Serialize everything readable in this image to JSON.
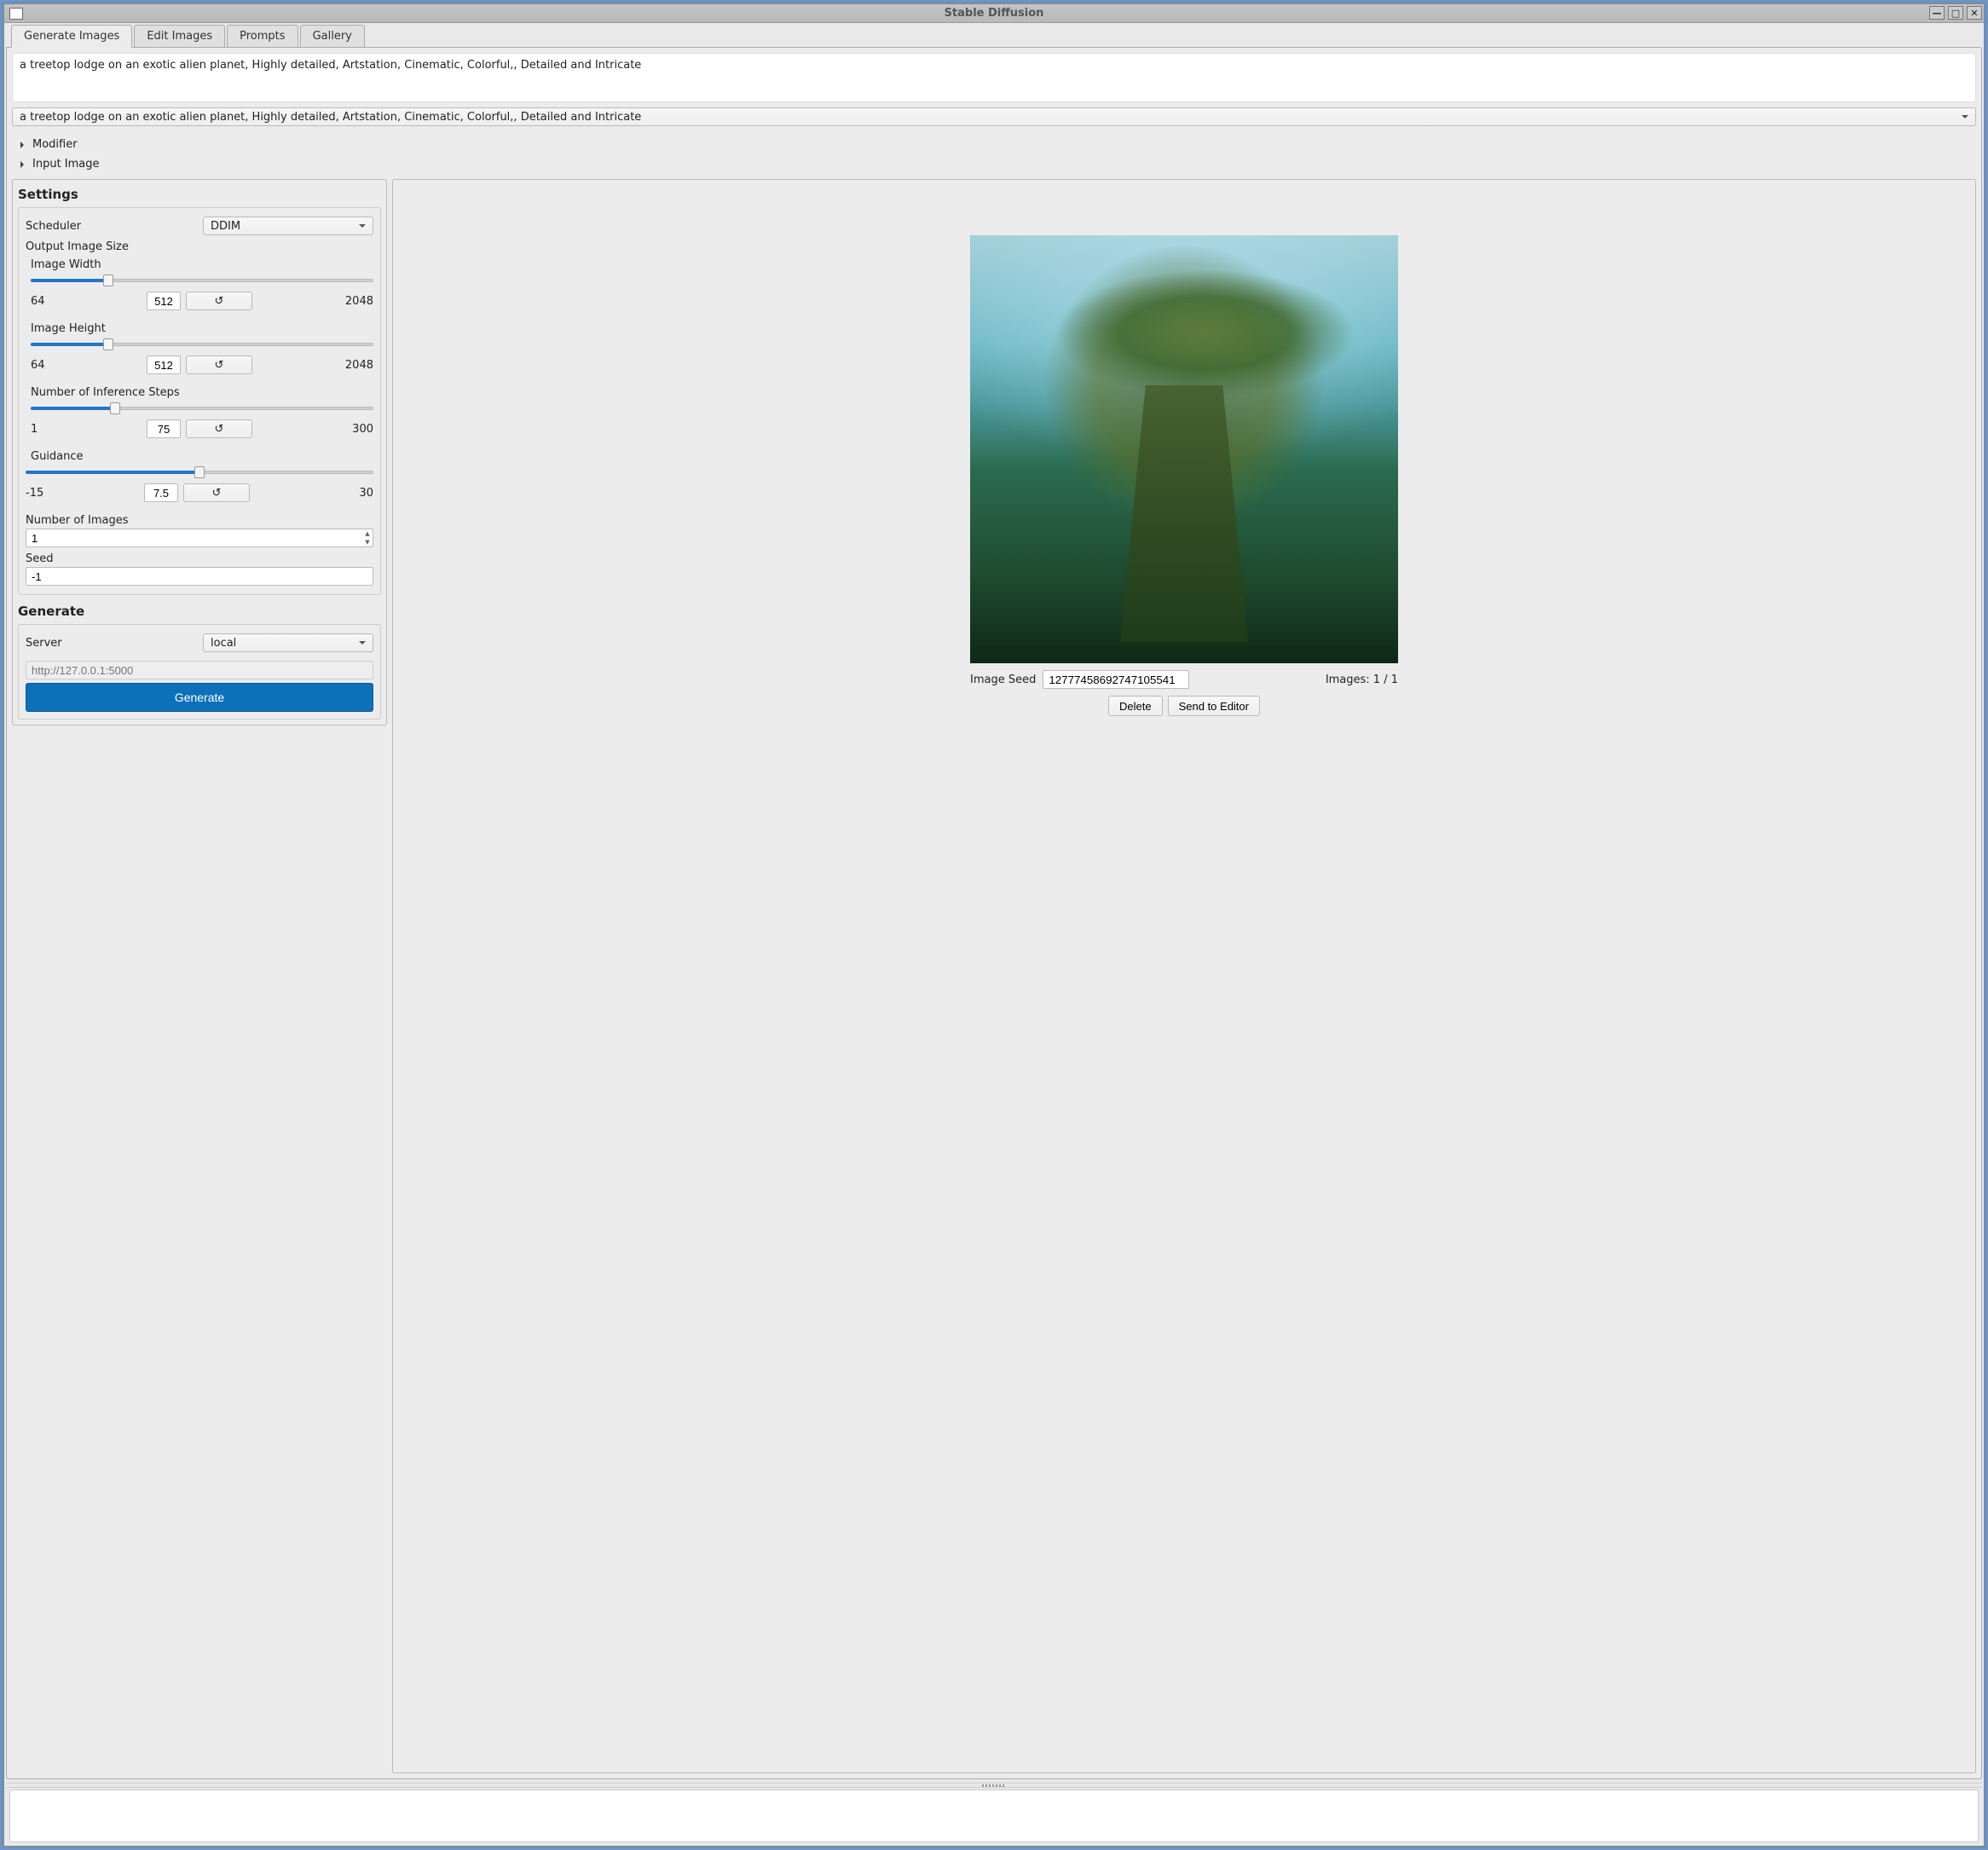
{
  "window": {
    "title": "Stable Diffusion"
  },
  "tabs": [
    "Generate Images",
    "Edit Images",
    "Prompts",
    "Gallery"
  ],
  "prompt_text": "a treetop lodge on an exotic alien planet, Highly detailed, Artstation, Cinematic, Colorful,, Detailed and Intricate",
  "prompt_dropdown": "a treetop lodge on an exotic alien planet, Highly detailed, Artstation, Cinematic, Colorful,, Detailed and Intricate",
  "expanders": {
    "modifier": "Modifier",
    "input_image": "Input Image"
  },
  "settings": {
    "heading": "Settings",
    "scheduler_label": "Scheduler",
    "scheduler_value": "DDIM",
    "output_size_label": "Output Image Size",
    "width": {
      "label": "Image Width",
      "min": "64",
      "max": "2048",
      "value": "512",
      "pct": 22.6
    },
    "height": {
      "label": "Image Height",
      "min": "64",
      "max": "2048",
      "value": "512",
      "pct": 22.6
    },
    "steps": {
      "label": "Number of Inference Steps",
      "min": "1",
      "max": "300",
      "value": "75",
      "pct": 24.7
    },
    "guidance": {
      "label": "Guidance",
      "min": "-15",
      "max": "30",
      "value": "7.5",
      "pct": 50.0
    },
    "num_images_label": "Number of Images",
    "num_images_value": "1",
    "seed_label": "Seed",
    "seed_value": "-1"
  },
  "generate": {
    "heading": "Generate",
    "server_label": "Server",
    "server_value": "local",
    "server_url_placeholder": "http://127.0.0.1:5000",
    "button": "Generate"
  },
  "preview": {
    "seed_label": "Image Seed",
    "seed_value": "12777458692747105541",
    "counter_label": "Images: 1 / 1",
    "delete": "Delete",
    "send": "Send to Editor"
  },
  "reset_glyph": "↺"
}
